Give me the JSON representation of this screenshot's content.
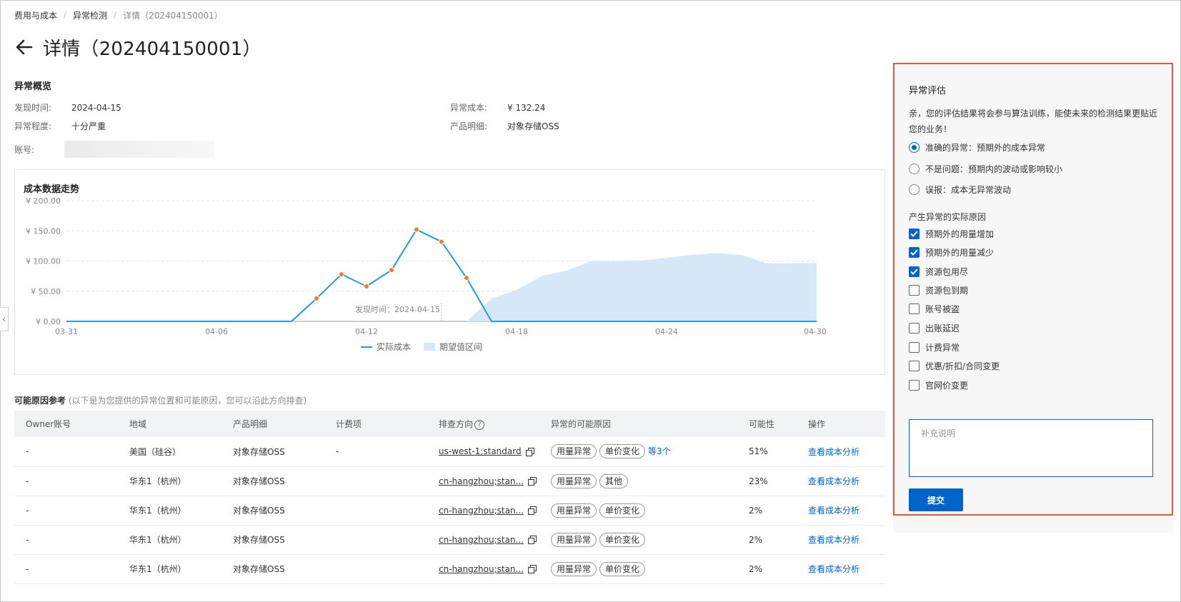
{
  "breadcrumb": [
    "费用与成本",
    "异常检测",
    "详情（202404150001）"
  ],
  "page": {
    "title": "详情（202404150001）"
  },
  "overview": {
    "section_title": "异常概览",
    "found_time_label": "发现时间:",
    "found_time": "2024-04-15",
    "severity_label": "异常程度:",
    "severity": "十分严重",
    "account_label": "账号:",
    "cost_label": "异常成本:",
    "cost": "¥ 132.24",
    "product_label": "产品明细:",
    "product": "对象存储OSS"
  },
  "chart": {
    "title": "成本数据走势",
    "annotation": "发现时间：2024-04-15"
  },
  "chart_data": {
    "type": "line",
    "title": "成本数据走势",
    "xlabel": "",
    "ylabel": "",
    "x": [
      "03-31",
      "04-01",
      "04-02",
      "04-03",
      "04-04",
      "04-05",
      "04-06",
      "04-07",
      "04-08",
      "04-09",
      "04-10",
      "04-11",
      "04-12",
      "04-13",
      "04-14",
      "04-15",
      "04-16",
      "04-17",
      "04-18",
      "04-19",
      "04-20",
      "04-21",
      "04-22",
      "04-23",
      "04-24",
      "04-25",
      "04-26",
      "04-27",
      "04-28",
      "04-29",
      "04-30"
    ],
    "x_ticks": [
      "03-31",
      "04-06",
      "04-12",
      "04-18",
      "04-24",
      "04-30"
    ],
    "y_ticks": [
      "¥ 0.00",
      "¥ 50.00",
      "¥ 100.00",
      "¥ 150.00",
      "¥ 200.00"
    ],
    "ylim": [
      0,
      200
    ],
    "grid": true,
    "legend_position": "bottom",
    "series": [
      {
        "name": "实际成本",
        "type": "line",
        "color": "#1f9be8",
        "values": [
          0,
          0,
          0,
          0,
          0,
          0,
          0,
          0,
          0,
          0,
          38,
          78,
          58,
          85,
          152,
          132,
          72,
          0,
          0,
          0,
          0,
          0,
          0,
          0,
          0,
          0,
          0,
          0,
          0,
          0,
          0
        ],
        "marker_color": "#f57c1f",
        "marked_points": [
          10,
          11,
          12,
          13,
          14,
          15,
          16
        ]
      },
      {
        "name": "期望值区间",
        "type": "area",
        "color": "#d6e8f7",
        "values": [
          0,
          0,
          0,
          0,
          0,
          0,
          0,
          0,
          0,
          0,
          0,
          0,
          0,
          0,
          0,
          0,
          0,
          38,
          52,
          75,
          84,
          100,
          100,
          101,
          105,
          110,
          113,
          110,
          96,
          96,
          97
        ]
      }
    ]
  },
  "reasons": {
    "title": "可能原因参考",
    "note": "(以下是为您提供的异常位置和可能原因，您可以沿此方向排查)",
    "columns": [
      "Owner账号",
      "地域",
      "产品明细",
      "计费项",
      "排查方向",
      "异常的可能原因",
      "可能性",
      "操作"
    ],
    "rows": [
      {
        "owner": "-",
        "region": "美国（硅谷）",
        "product": "对象存储OSS",
        "billing_item": "-",
        "direction": "us-west-1;standard",
        "tags": [
          "用量异常",
          "单价变化"
        ],
        "more": "等3个",
        "probability": "51%",
        "action": "查看成本分析"
      },
      {
        "owner": "-",
        "region": "华东1（杭州）",
        "product": "对象存储OSS",
        "billing_item": "",
        "direction": "cn-hangzhou;stan...",
        "tags": [
          "用量异常",
          "其他"
        ],
        "more": "",
        "probability": "23%",
        "action": "查看成本分析"
      },
      {
        "owner": "-",
        "region": "华东1（杭州）",
        "product": "对象存储OSS",
        "billing_item": "",
        "direction": "cn-hangzhou;stan...",
        "tags": [
          "用量异常",
          "单价变化"
        ],
        "more": "",
        "probability": "2%",
        "action": "查看成本分析"
      },
      {
        "owner": "-",
        "region": "华东1（杭州）",
        "product": "对象存储OSS",
        "billing_item": "",
        "direction": "cn-hangzhou;stan...",
        "tags": [
          "用量异常",
          "单价变化"
        ],
        "more": "",
        "probability": "2%",
        "action": "查看成本分析"
      },
      {
        "owner": "-",
        "region": "华东1（杭州）",
        "product": "对象存储OSS",
        "billing_item": "",
        "direction": "cn-hangzhou;stan...",
        "tags": [
          "用量异常",
          "单价变化"
        ],
        "more": "",
        "probability": "2%",
        "action": "查看成本分析"
      }
    ]
  },
  "evaluation": {
    "title": "异常评估",
    "description": "亲，您的评估结果将会参与算法训练，能使未来的检测结果更贴近您的业务！",
    "options": [
      {
        "label": "准确的异常：预期外的成本异常",
        "selected": true
      },
      {
        "label": "不是问题：预期内的波动或影响较小",
        "selected": false
      },
      {
        "label": "误报：成本无异常波动",
        "selected": false
      }
    ],
    "cause_title": "产生异常的实际原因",
    "causes": [
      {
        "label": "预期外的用量增加",
        "checked": true
      },
      {
        "label": "预期外的用量减少",
        "checked": true
      },
      {
        "label": "资源包用尽",
        "checked": true
      },
      {
        "label": "资源包到期",
        "checked": false
      },
      {
        "label": "账号被盗",
        "checked": false
      },
      {
        "label": "出账延迟",
        "checked": false
      },
      {
        "label": "计费异常",
        "checked": false
      },
      {
        "label": "优惠/折扣/合同变更",
        "checked": false
      },
      {
        "label": "官网价变更",
        "checked": false
      }
    ],
    "note_placeholder": "补充说明",
    "submit_label": "提交",
    "highlight_color": "#e8553f"
  },
  "colors": {
    "accent": "#0064c8",
    "line": "#1f9be8",
    "marker": "#f57c1f",
    "band": "#d6e8f7"
  },
  "icons": [
    "back-arrow-icon",
    "copy-icon",
    "help-icon",
    "collapse-left-icon"
  ]
}
